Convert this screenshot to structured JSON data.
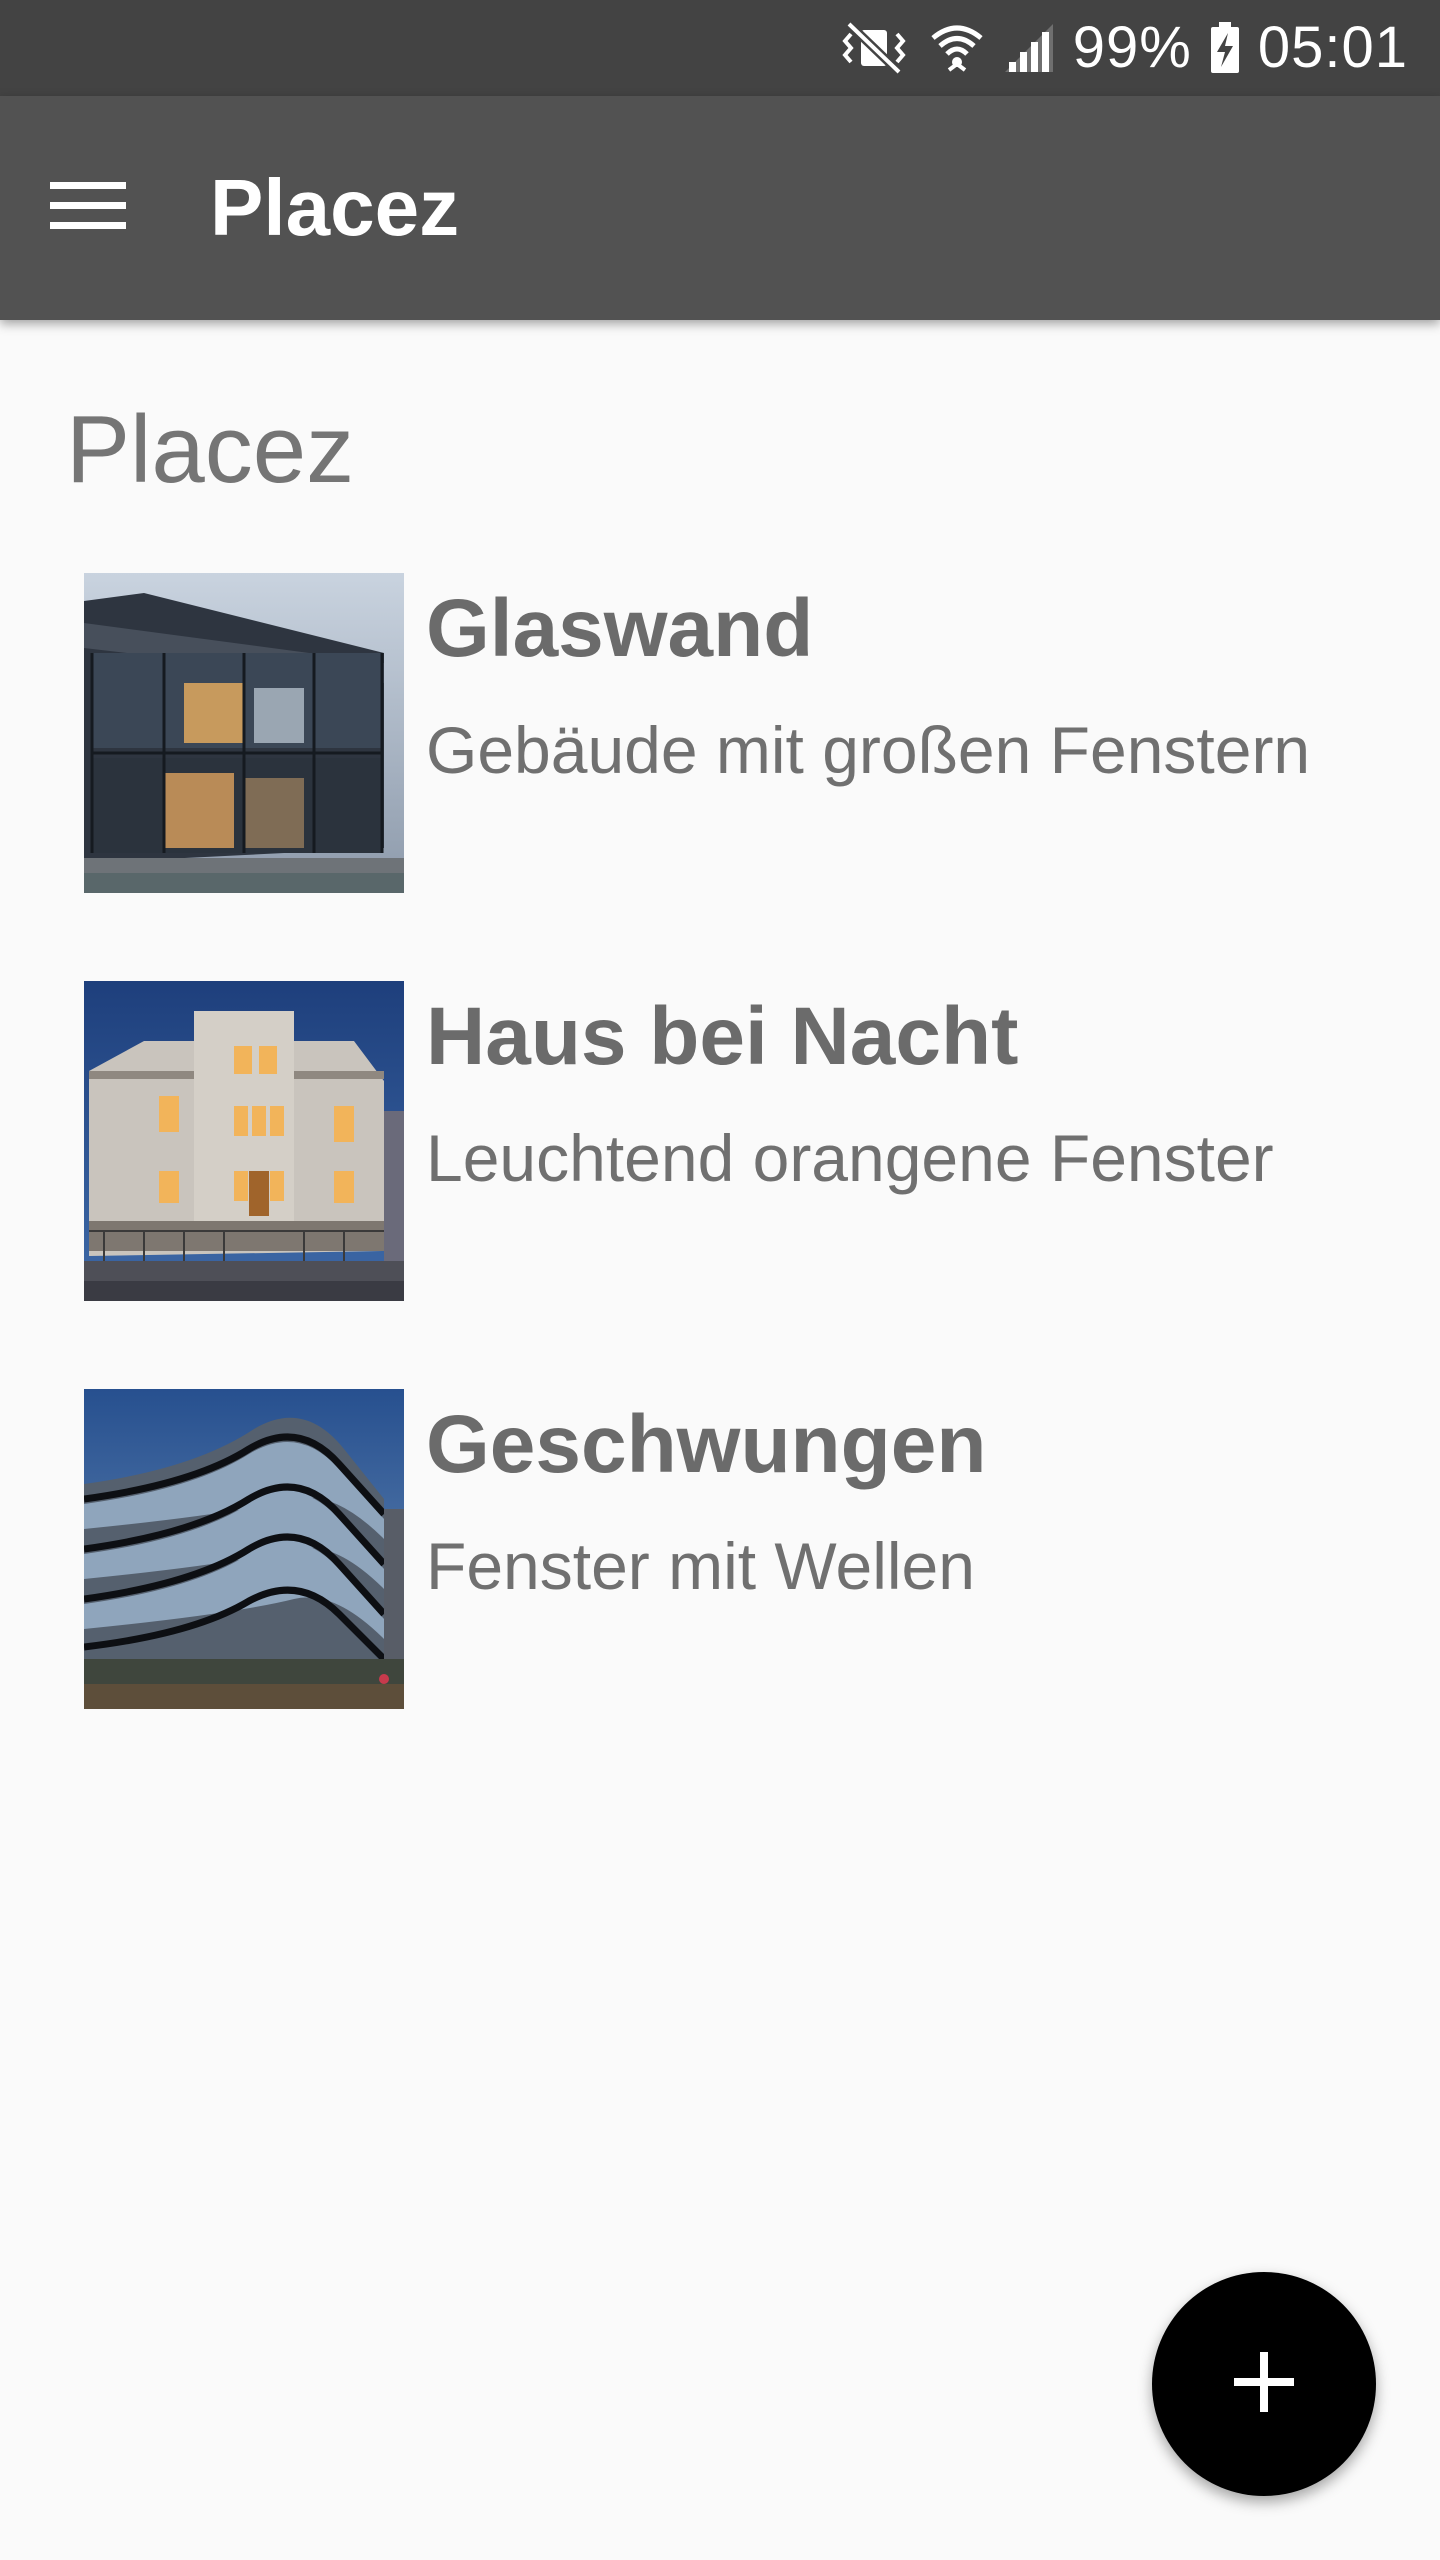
{
  "status_bar": {
    "battery": "99%",
    "time": "05:01",
    "icons": [
      "vibrate-mute-icon",
      "wifi-icon",
      "signal-icon",
      "battery-charging-icon"
    ]
  },
  "app_bar": {
    "title": "Placez",
    "menu_icon": "hamburger-menu-icon"
  },
  "main": {
    "section_title": "Placez",
    "items": [
      {
        "title": "Glaswand",
        "subtitle": "Gebäude mit großen Fenstern",
        "image": "glass-building-thumbnail"
      },
      {
        "title": "Haus bei Nacht",
        "subtitle": "Leuchtend orangene Fenster",
        "image": "house-at-night-thumbnail"
      },
      {
        "title": "Geschwungen",
        "subtitle": "Fenster mit Wellen",
        "image": "curved-building-thumbnail"
      }
    ]
  },
  "fab": {
    "icon": "plus-icon"
  },
  "colors": {
    "status_bar": "#434343",
    "app_bar": "#525252",
    "background": "#fafafa",
    "fab": "#000000"
  }
}
